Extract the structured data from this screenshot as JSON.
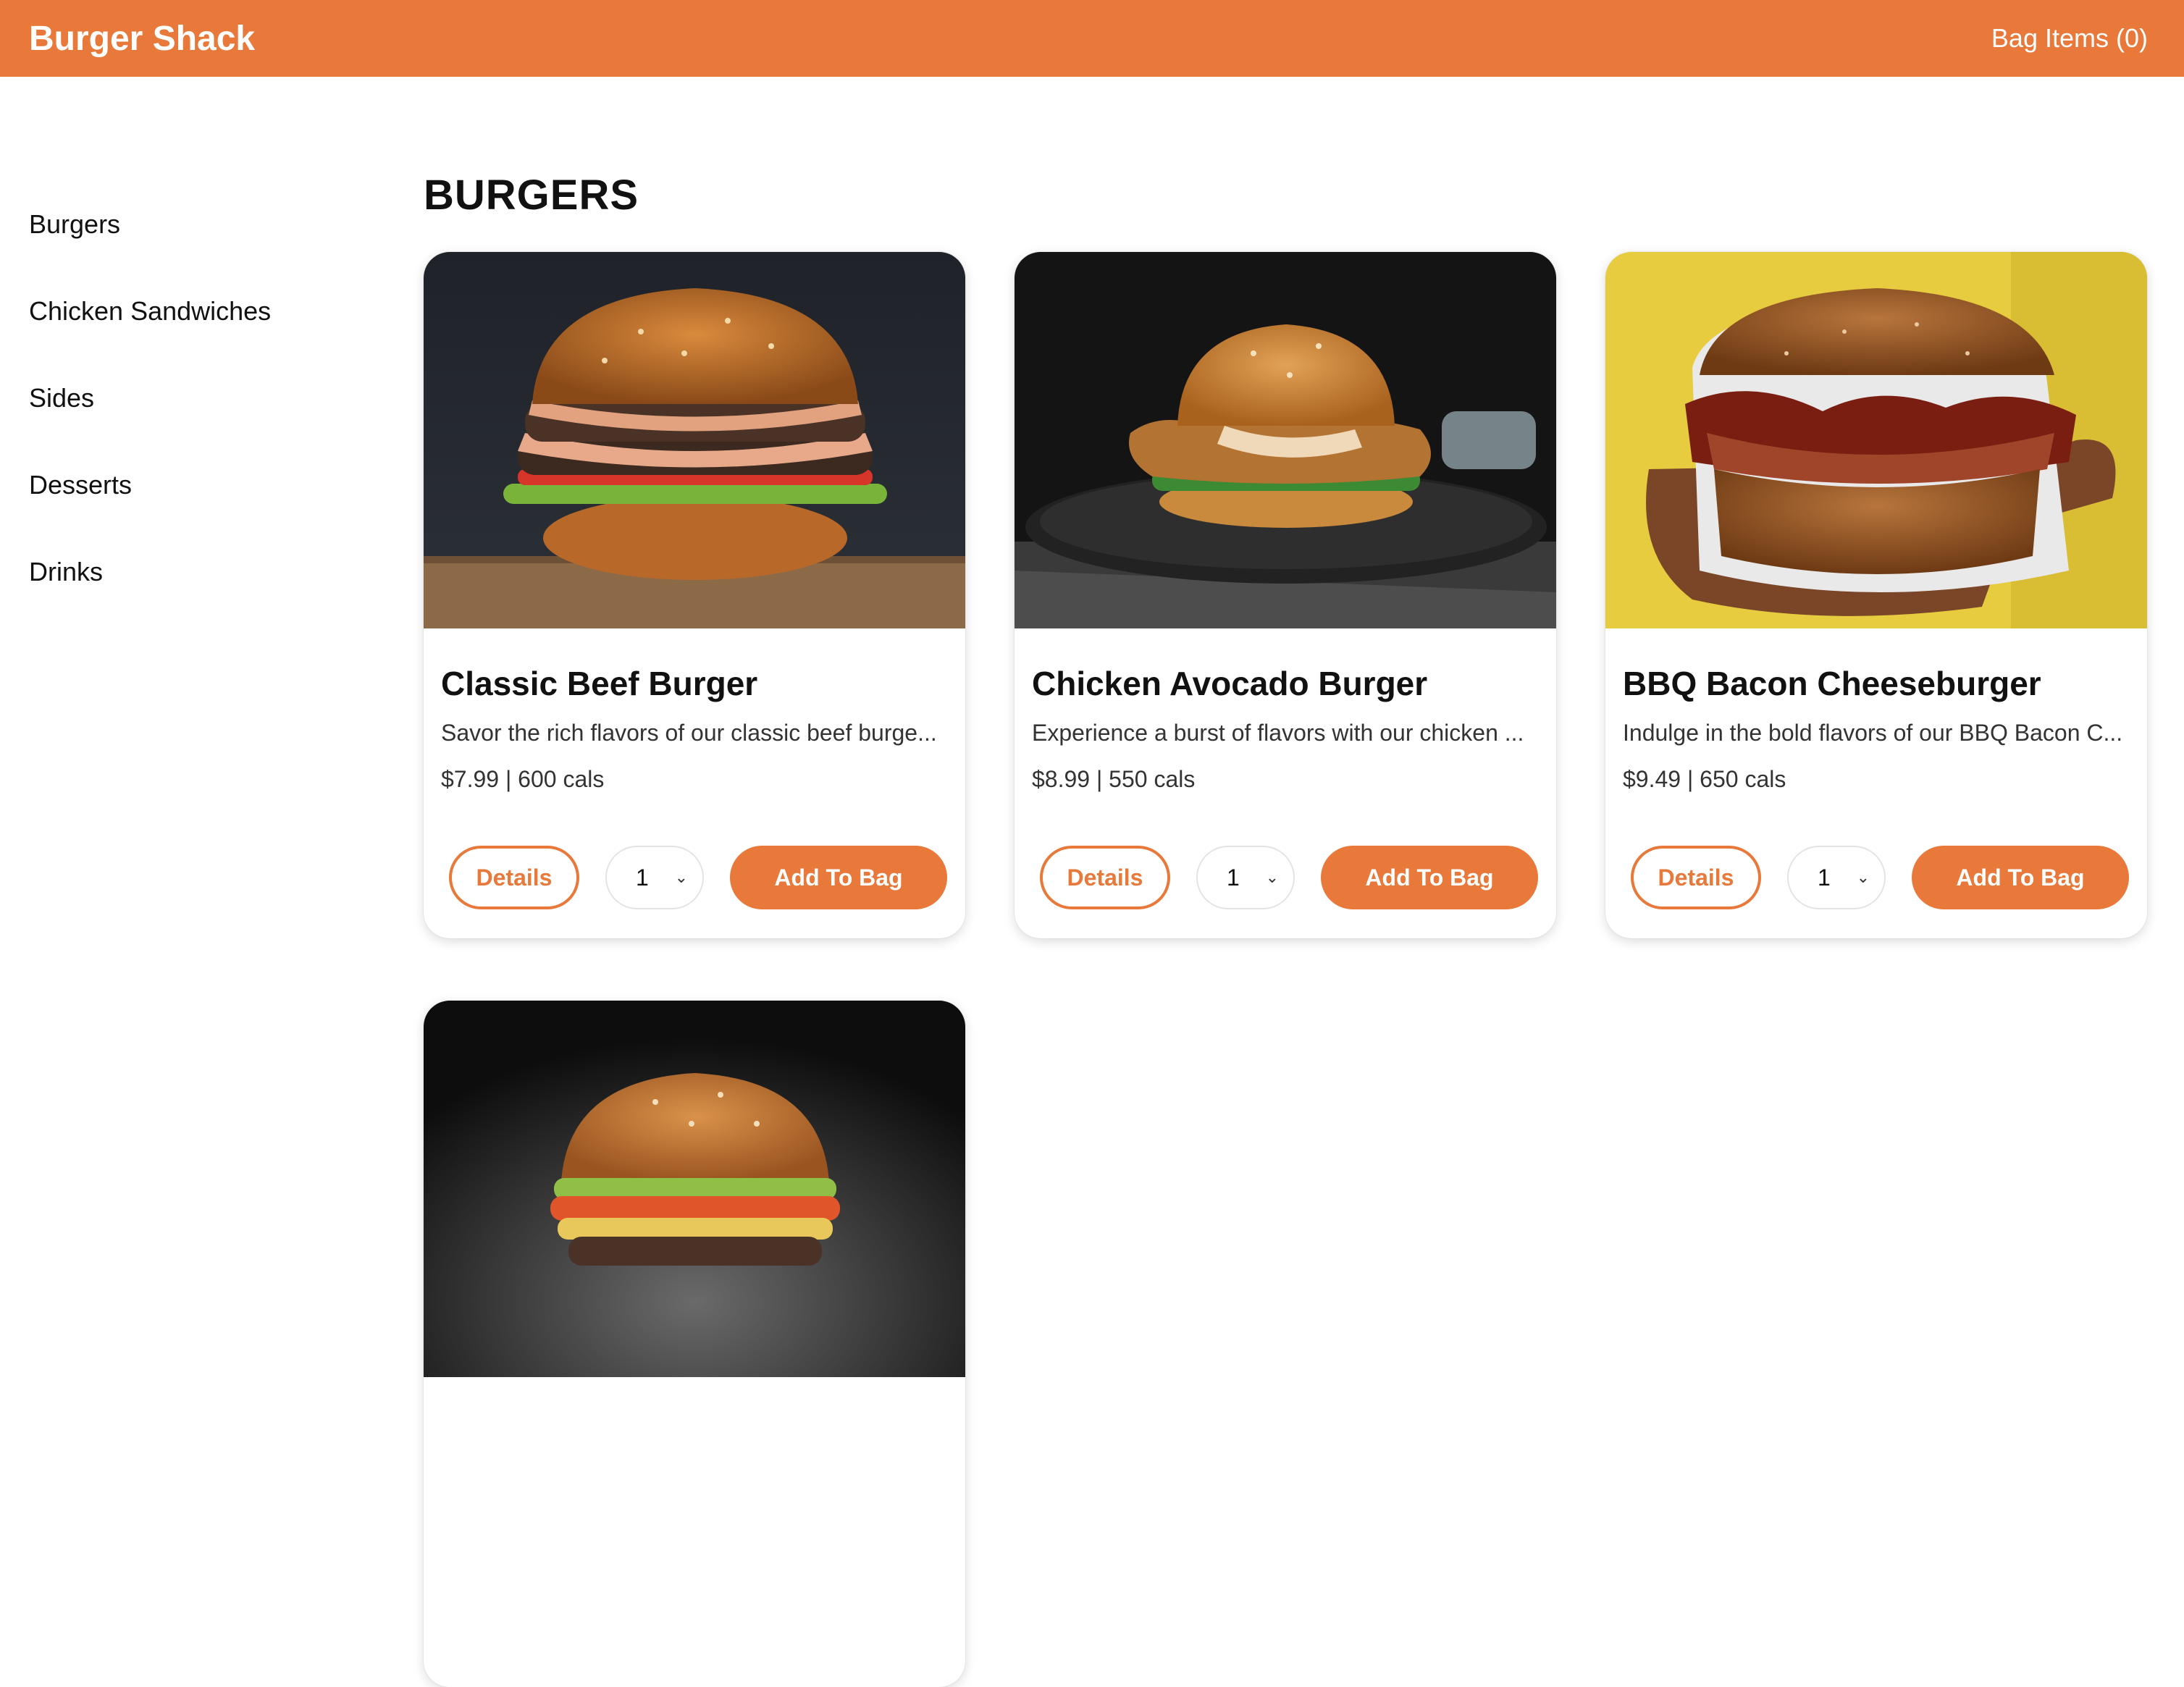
{
  "header": {
    "brand": "Burger Shack",
    "bag_label": "Bag Items (0)",
    "accent_color": "#E8793A"
  },
  "sidebar": {
    "items": [
      {
        "label": "Burgers"
      },
      {
        "label": "Chicken Sandwiches"
      },
      {
        "label": "Sides"
      },
      {
        "label": "Desserts"
      },
      {
        "label": "Drinks"
      }
    ]
  },
  "main": {
    "section_title": "BURGERS",
    "cards": [
      {
        "title": "Classic Beef Burger",
        "description": "Savor the rich flavors of our classic beef burge...",
        "meta": "$7.99 | 600 cals",
        "details_label": "Details",
        "qty": "1",
        "add_label": "Add To Bag",
        "image_icon": "beef-burger-photo"
      },
      {
        "title": "Chicken Avocado Burger",
        "description": "Experience a burst of flavors with our chicken ...",
        "meta": "$8.99 | 550 cals",
        "details_label": "Details",
        "qty": "1",
        "add_label": "Add To Bag",
        "image_icon": "chicken-burger-photo"
      },
      {
        "title": "BBQ Bacon Cheeseburger",
        "description": "Indulge in the bold flavors of our BBQ Bacon C...",
        "meta": "$9.49 | 650 cals",
        "details_label": "Details",
        "qty": "1",
        "add_label": "Add To Bag",
        "image_icon": "bbq-burger-photo"
      }
    ],
    "partial_card": {
      "image_icon": "veggie-burger-photo"
    }
  }
}
